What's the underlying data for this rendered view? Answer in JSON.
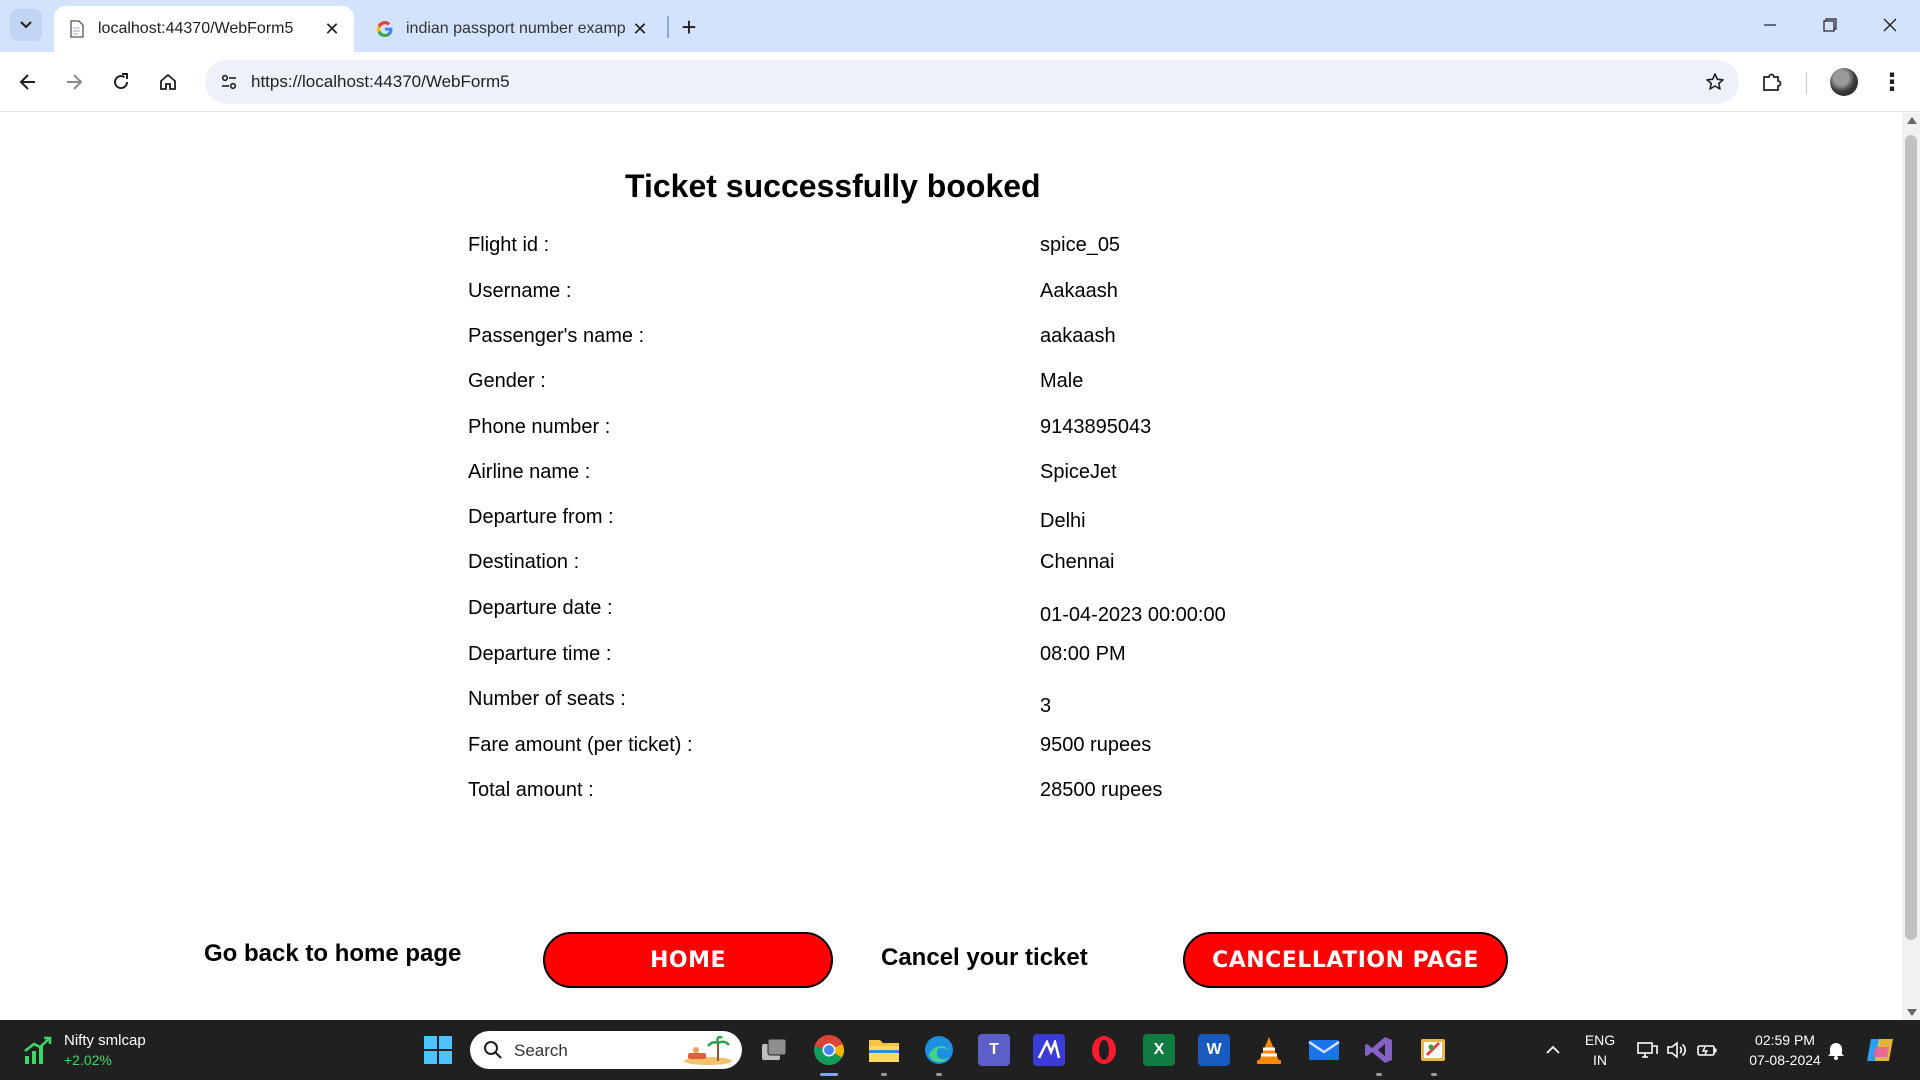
{
  "browser": {
    "tabs": [
      {
        "title": "localhost:44370/WebForm5",
        "active": true
      },
      {
        "title": "indian passport number examp",
        "active": false
      }
    ],
    "url": "https://localhost:44370/WebForm5"
  },
  "page": {
    "heading": "Ticket successfully booked",
    "rows": [
      {
        "label": "Flight id :",
        "value": "spice_05"
      },
      {
        "label": "Username :",
        "value": "Aakaash"
      },
      {
        "label": "Passenger's name :",
        "value": "aakaash"
      },
      {
        "label": "Gender :",
        "value": "Male"
      },
      {
        "label": "Phone number :",
        "value": "9143895043"
      },
      {
        "label": "Airline name :",
        "value": "SpiceJet"
      },
      {
        "label": "Departure from :",
        "value": "Delhi"
      },
      {
        "label": "Destination :",
        "value": "Chennai"
      },
      {
        "label": "Departure date :",
        "value": "01-04-2023 00:00:00"
      },
      {
        "label": "Departure time :",
        "value": "08:00 PM"
      },
      {
        "label": "Number of seats :",
        "value": "3"
      },
      {
        "label": "Fare amount (per ticket) :",
        "value": "9500 rupees"
      },
      {
        "label": "Total amount :",
        "value": "28500 rupees"
      }
    ],
    "home_text": "Go back to home page",
    "home_button": "HOME",
    "cancel_text": "Cancel your ticket",
    "cancel_button": "CANCELLATION PAGE",
    "button_color": "#ff0000"
  },
  "taskbar": {
    "widget_title": "Nifty smlcap",
    "widget_change": "+2.02%",
    "search_placeholder": "Search",
    "lang_line1": "ENG",
    "lang_line2": "IN",
    "time": "02:59 PM",
    "date": "07-08-2024",
    "apps": [
      "windows-start",
      "search",
      "task-view",
      "chrome",
      "file-explorer",
      "edge",
      "teams",
      "visual-studio-code-like",
      "opera",
      "excel",
      "word",
      "vlc",
      "mail",
      "visual-studio",
      "paint"
    ]
  }
}
